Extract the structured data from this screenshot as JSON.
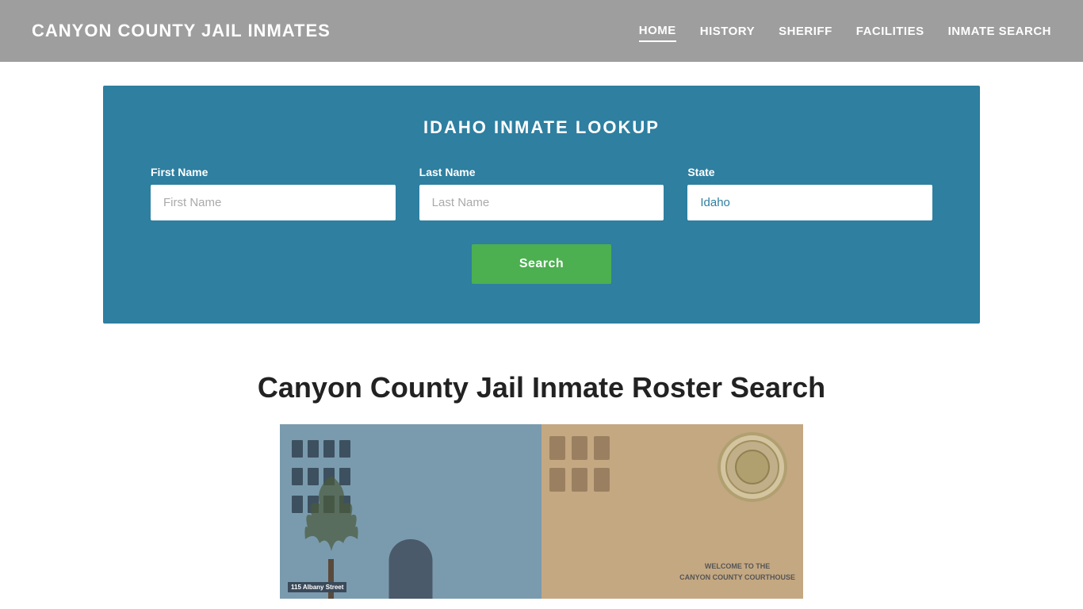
{
  "header": {
    "site_title": "Canyon County Jail Inmates",
    "nav": {
      "items": [
        {
          "label": "HOME",
          "active": true
        },
        {
          "label": "HISTORY",
          "active": false
        },
        {
          "label": "SHERIFF",
          "active": false
        },
        {
          "label": "FACILITIES",
          "active": false
        },
        {
          "label": "INMATE SEARCH",
          "active": false
        }
      ]
    }
  },
  "search_panel": {
    "title": "IDAHO INMATE LOOKUP",
    "fields": {
      "first_name_label": "First Name",
      "first_name_placeholder": "First Name",
      "last_name_label": "Last Name",
      "last_name_placeholder": "Last Name",
      "state_label": "State",
      "state_value": "Idaho"
    },
    "search_button_label": "Search"
  },
  "main": {
    "roster_title": "Canyon County Jail Inmate Roster Search",
    "courthouse_street": "115 Albany Street",
    "welcome_line1": "Welcome to the",
    "welcome_line2": "Canyon County Courthouse"
  }
}
